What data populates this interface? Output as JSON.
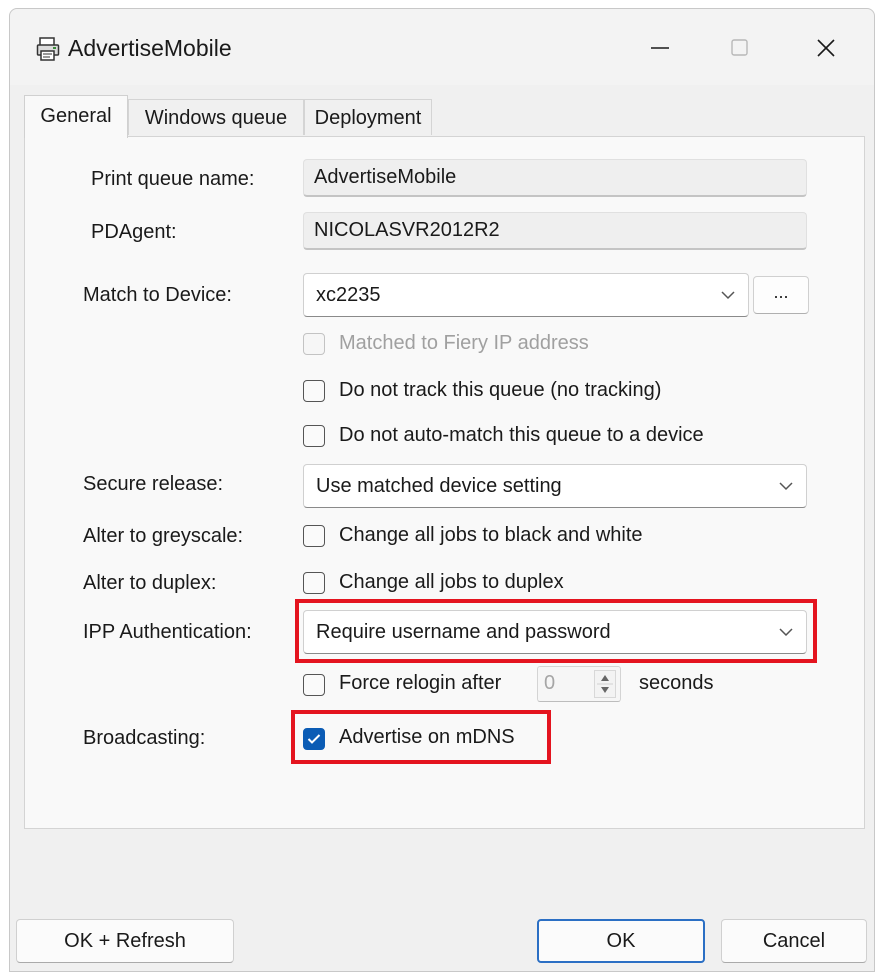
{
  "window": {
    "title": "AdvertiseMobile",
    "icon": "printer-icon"
  },
  "tabs": [
    {
      "label": "General",
      "active": true
    },
    {
      "label": "Windows queue",
      "active": false
    },
    {
      "label": "Deployment",
      "active": false
    }
  ],
  "general": {
    "print_queue_name": {
      "label": "Print queue name:",
      "value": "AdvertiseMobile"
    },
    "pdagent": {
      "label": "PDAgent:",
      "value": "NICOLASVR2012R2"
    },
    "match_to_device": {
      "label": "Match to Device:",
      "value": "xc2235",
      "browse_label": "..."
    },
    "matched_fiery": {
      "label": "Matched to Fiery IP address",
      "checked": false,
      "disabled": true
    },
    "no_tracking": {
      "label": "Do not track this queue (no tracking)",
      "checked": false
    },
    "no_auto_match": {
      "label": "Do not auto-match this queue to a device",
      "checked": false
    },
    "secure_release": {
      "label": "Secure release:",
      "value": "Use matched device setting"
    },
    "greyscale": {
      "label": "Alter to greyscale:",
      "checkbox_label": "Change all jobs to black and white",
      "checked": false
    },
    "duplex": {
      "label": "Alter to duplex:",
      "checkbox_label": "Change all jobs to duplex",
      "checked": false
    },
    "ipp_auth": {
      "label": "IPP Authentication:",
      "value": "Require username and password"
    },
    "force_relogin": {
      "label": "Force relogin after",
      "value": "0",
      "unit": "seconds",
      "checked": false
    },
    "broadcasting": {
      "label": "Broadcasting:",
      "checkbox_label": "Advertise on mDNS",
      "checked": true
    }
  },
  "buttons": {
    "ok_refresh": "OK + Refresh",
    "ok": "OK",
    "cancel": "Cancel"
  },
  "colors": {
    "accent": "#0b5cb5",
    "highlight": "#e4141f"
  }
}
